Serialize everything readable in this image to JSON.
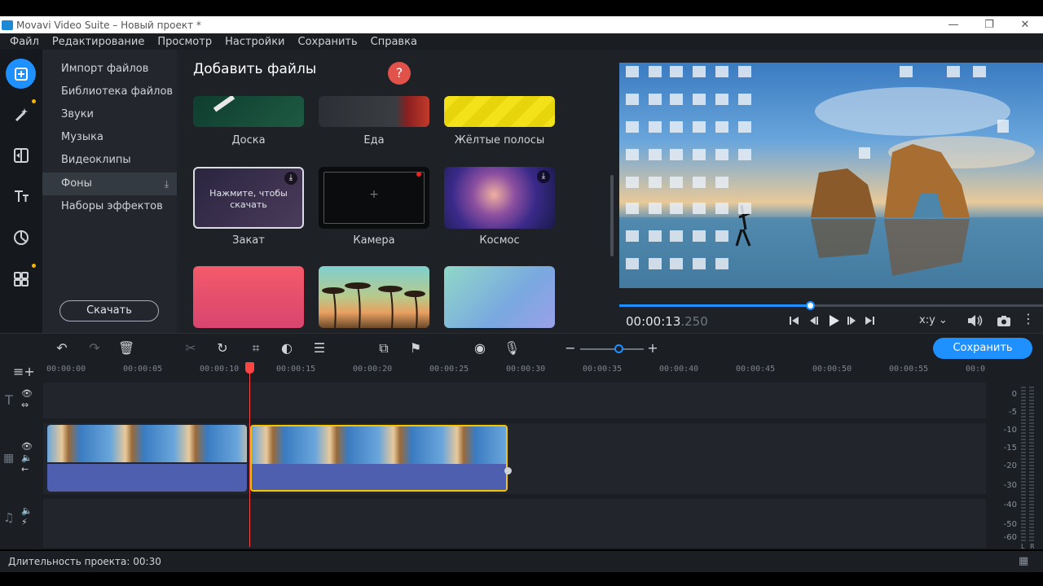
{
  "window": {
    "title": "Movavi Video Suite – Новый проект *",
    "minimize": "—",
    "restore": "❐",
    "close": "✕"
  },
  "menu": [
    "Файл",
    "Редактирование",
    "Просмотр",
    "Настройки",
    "Сохранить",
    "Справка"
  ],
  "left_tools": [
    "import-icon",
    "magic-wand-icon",
    "transition-icon",
    "titles-icon",
    "stickers-icon",
    "more-tools-icon"
  ],
  "categories": [
    {
      "label": "Импорт файлов"
    },
    {
      "label": "Библиотека файлов"
    },
    {
      "label": "Звуки"
    },
    {
      "label": "Музыка"
    },
    {
      "label": "Видеоклипы"
    },
    {
      "label": "Фоны",
      "active": true
    },
    {
      "label": "Наборы эффектов"
    }
  ],
  "download_button": "Скачать",
  "files": {
    "title": "Добавить файлы",
    "tiles": [
      {
        "label": "Доска"
      },
      {
        "label": "Еда"
      },
      {
        "label": "Жёлтые полосы"
      },
      {
        "label": "Закат",
        "overlay": "Нажмите, чтобы скачать"
      },
      {
        "label": "Камера"
      },
      {
        "label": "Космос"
      },
      {
        "label": ""
      },
      {
        "label": ""
      },
      {
        "label": ""
      }
    ]
  },
  "help_icon": "?",
  "player": {
    "timecode_main": "00:00:13",
    "timecode_ms": ".250",
    "progress": 0.45,
    "aspect": "x:y"
  },
  "edit_toolbar": {
    "save_label": "Сохранить",
    "zoom": 0.6
  },
  "ruler_ticks": [
    "00:00:00",
    "00:00:05",
    "00:00:10",
    "00:00:15",
    "00:00:20",
    "00:00:25",
    "00:00:30",
    "00:00:35",
    "00:00:40",
    "00:00:45",
    "00:00:50",
    "00:00:55",
    "00:0"
  ],
  "meter_labels": [
    "0",
    "-5",
    "-10",
    "-15",
    "-20",
    "-30",
    "-40",
    "-50",
    "-60"
  ],
  "meter_channels": [
    "L",
    "R"
  ],
  "status": {
    "duration": "Длительность проекта: 00:30"
  },
  "colors": {
    "accent": "#1e90ff",
    "clip_selected_border": "#f5c400",
    "playhead": "#ff4444",
    "help": "#e0524a"
  }
}
